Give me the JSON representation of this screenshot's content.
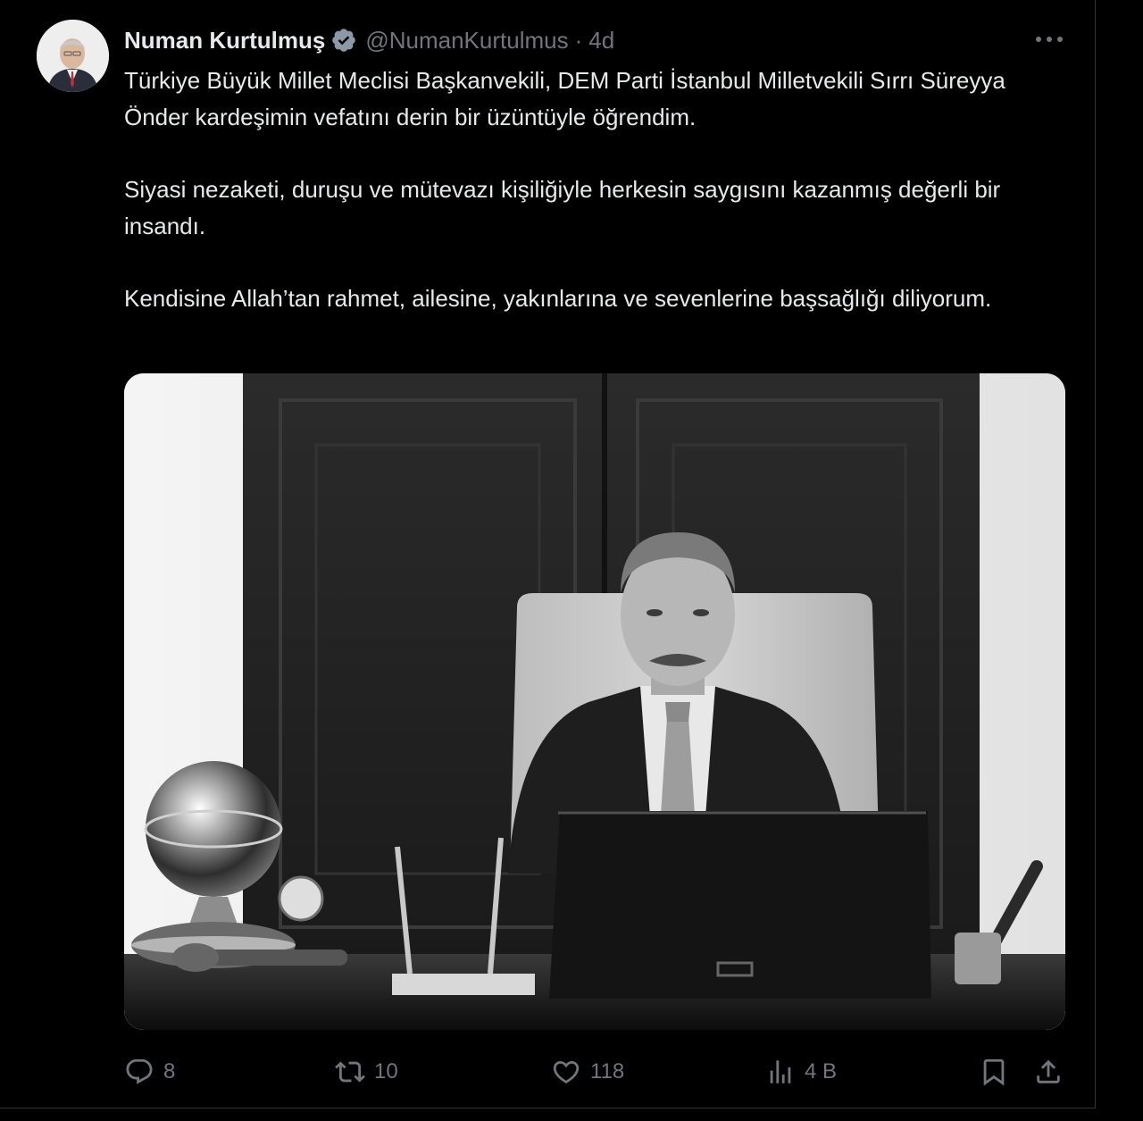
{
  "tweet": {
    "author": {
      "display_name": "Numan Kurtulmuş",
      "handle": "@NumanKurtulmus",
      "verified": true
    },
    "separator": "·",
    "time": "4d",
    "paragraphs": [
      "Türkiye Büyük Millet Meclisi Başkanvekili, DEM Parti İstanbul Milletvekili Sırrı Süreyya Önder kardeşimin vefatını derin bir üzüntüyle öğrendim.",
      "Siyasi nezaketi, duruşu ve mütevazı kişiliğiyle herkesin saygısını kazanmış değerli bir insandı.",
      "Kendisine Allah’tan rahmet, ailesine, yakınlarına ve sevenlerine başsağlığı diliyorum."
    ],
    "stats": {
      "replies": "8",
      "retweets": "10",
      "likes": "118",
      "views": "4 B"
    }
  },
  "icons": {
    "verified": "verified-badge-icon",
    "more": "more-dots-icon",
    "reply": "reply-icon",
    "retweet": "retweet-icon",
    "like": "heart-icon",
    "views": "views-icon",
    "bookmark": "bookmark-icon",
    "share": "share-icon"
  },
  "colors": {
    "background": "#000000",
    "text": "#e7e9ea",
    "muted": "#71767b",
    "verified_badge": "#8b98a5"
  }
}
